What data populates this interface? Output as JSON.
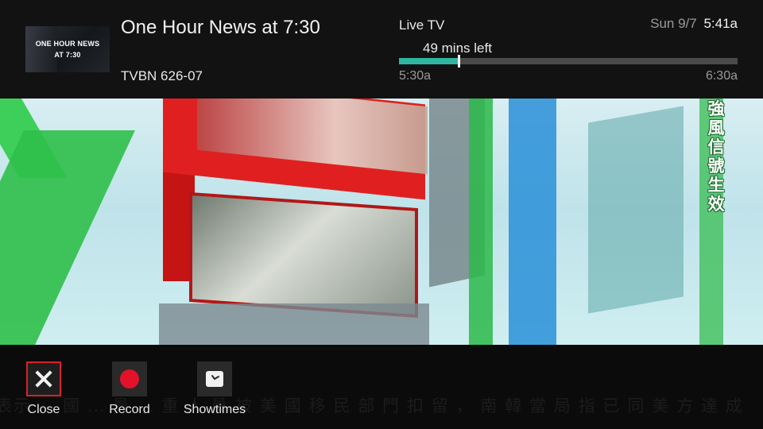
{
  "program": {
    "thumbnail_line1": "ONE HOUR NEWS",
    "thumbnail_line2": "AT 7:30",
    "title": "One Hour News at 7:30",
    "channel": "TVBN 626-07"
  },
  "status": {
    "source": "Live TV",
    "date": "Sun 9/7",
    "time": "5:41a"
  },
  "progress": {
    "remaining_label": "49 mins left",
    "start": "5:30a",
    "end": "6:30a",
    "elapsed_percent": 17.5
  },
  "video": {
    "vertical_caption": [
      "強",
      "風",
      "信",
      "號",
      "生",
      "效"
    ],
    "ticker_text": "表示 ... 國 ... 員 ... 重 人 員 被 美 國 移 民 部 門 扣 留 ， 南 韓 當 局 指 已 同 美 方 達 成"
  },
  "actions": [
    {
      "label": "Close",
      "icon": "close-icon"
    },
    {
      "label": "Record",
      "icon": "record-icon"
    },
    {
      "label": "Showtimes",
      "icon": "clock-icon"
    }
  ],
  "colors": {
    "accent": "#2fb5a0",
    "record": "#e3122a",
    "focus_border": "#d8222a"
  }
}
